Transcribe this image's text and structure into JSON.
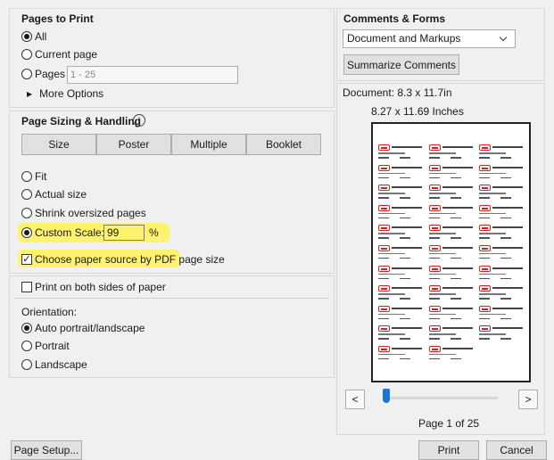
{
  "pages_to_print": {
    "title": "Pages to Print",
    "all_label": "All",
    "current_label": "Current page",
    "pages_label": "Pages",
    "pages_value": "1 - 25",
    "more_options_label": "More Options"
  },
  "sizing": {
    "title": "Page Sizing & Handling",
    "info_icon": "info-icon",
    "tabs": [
      "Size",
      "Poster",
      "Multiple",
      "Booklet"
    ],
    "fit_label": "Fit",
    "actual_label": "Actual size",
    "shrink_label": "Shrink oversized pages",
    "custom_label": "Custom Scale:",
    "custom_value": "99",
    "percent_label": "%",
    "paper_source_label": "Choose paper source by PDF page size",
    "highlight_color": "#fff26e"
  },
  "both_sides_label": "Print on both sides of paper",
  "orientation": {
    "title": "Orientation:",
    "auto_label": "Auto portrait/landscape",
    "portrait_label": "Portrait",
    "landscape_label": "Landscape"
  },
  "comments": {
    "title": "Comments & Forms",
    "selected": "Document and Markups",
    "summarize_label": "Summarize Comments"
  },
  "preview": {
    "document_label": "Document: 8.3 x 11.7in",
    "size_label": "8.27 x 11.69 Inches",
    "page_label": "Page 1 of 25",
    "prev_label": "<",
    "next_label": ">"
  },
  "footer": {
    "page_setup_label": "Page Setup...",
    "print_label": "Print",
    "cancel_label": "Cancel"
  }
}
